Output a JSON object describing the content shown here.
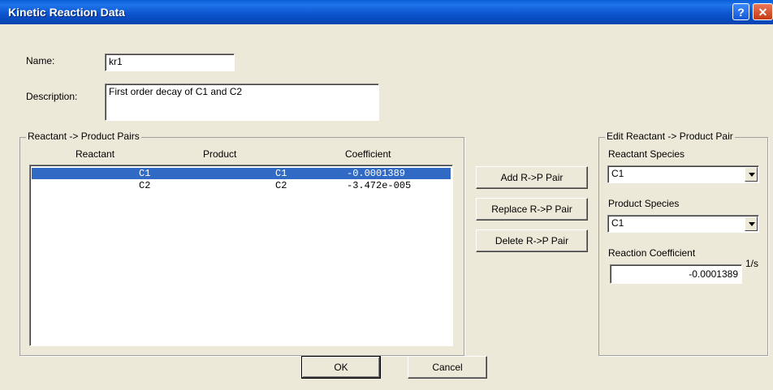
{
  "window": {
    "title": "Kinetic Reaction Data"
  },
  "form": {
    "name_label": "Name:",
    "name_value": "kr1",
    "description_label": "Description:",
    "description_value": "First order decay of C1 and C2"
  },
  "pairs": {
    "group_title": "Reactant -> Product Pairs",
    "columns": [
      "Reactant",
      "Product",
      "Coefficient"
    ],
    "rows": [
      {
        "reactant": "C1",
        "product": "C1",
        "coefficient": "-0.0001389",
        "selected": true
      },
      {
        "reactant": "C2",
        "product": "C2",
        "coefficient": "-3.472e-005",
        "selected": false
      }
    ]
  },
  "actions": {
    "add": "Add R->P Pair",
    "replace": "Replace R->P Pair",
    "delete": "Delete R->P Pair"
  },
  "edit": {
    "group_title": "Edit Reactant -> Product Pair",
    "reactant_label": "Reactant Species",
    "reactant_value": "C1",
    "product_label": "Product Species",
    "product_value": "C1",
    "coef_label": "Reaction Coefficient",
    "coef_value": "-0.0001389",
    "unit": "1/s"
  },
  "footer": {
    "ok": "OK",
    "cancel": "Cancel"
  },
  "colors": {
    "titlebar": "#0a52cc",
    "selection": "#316ac5",
    "face": "#ece9d8"
  }
}
